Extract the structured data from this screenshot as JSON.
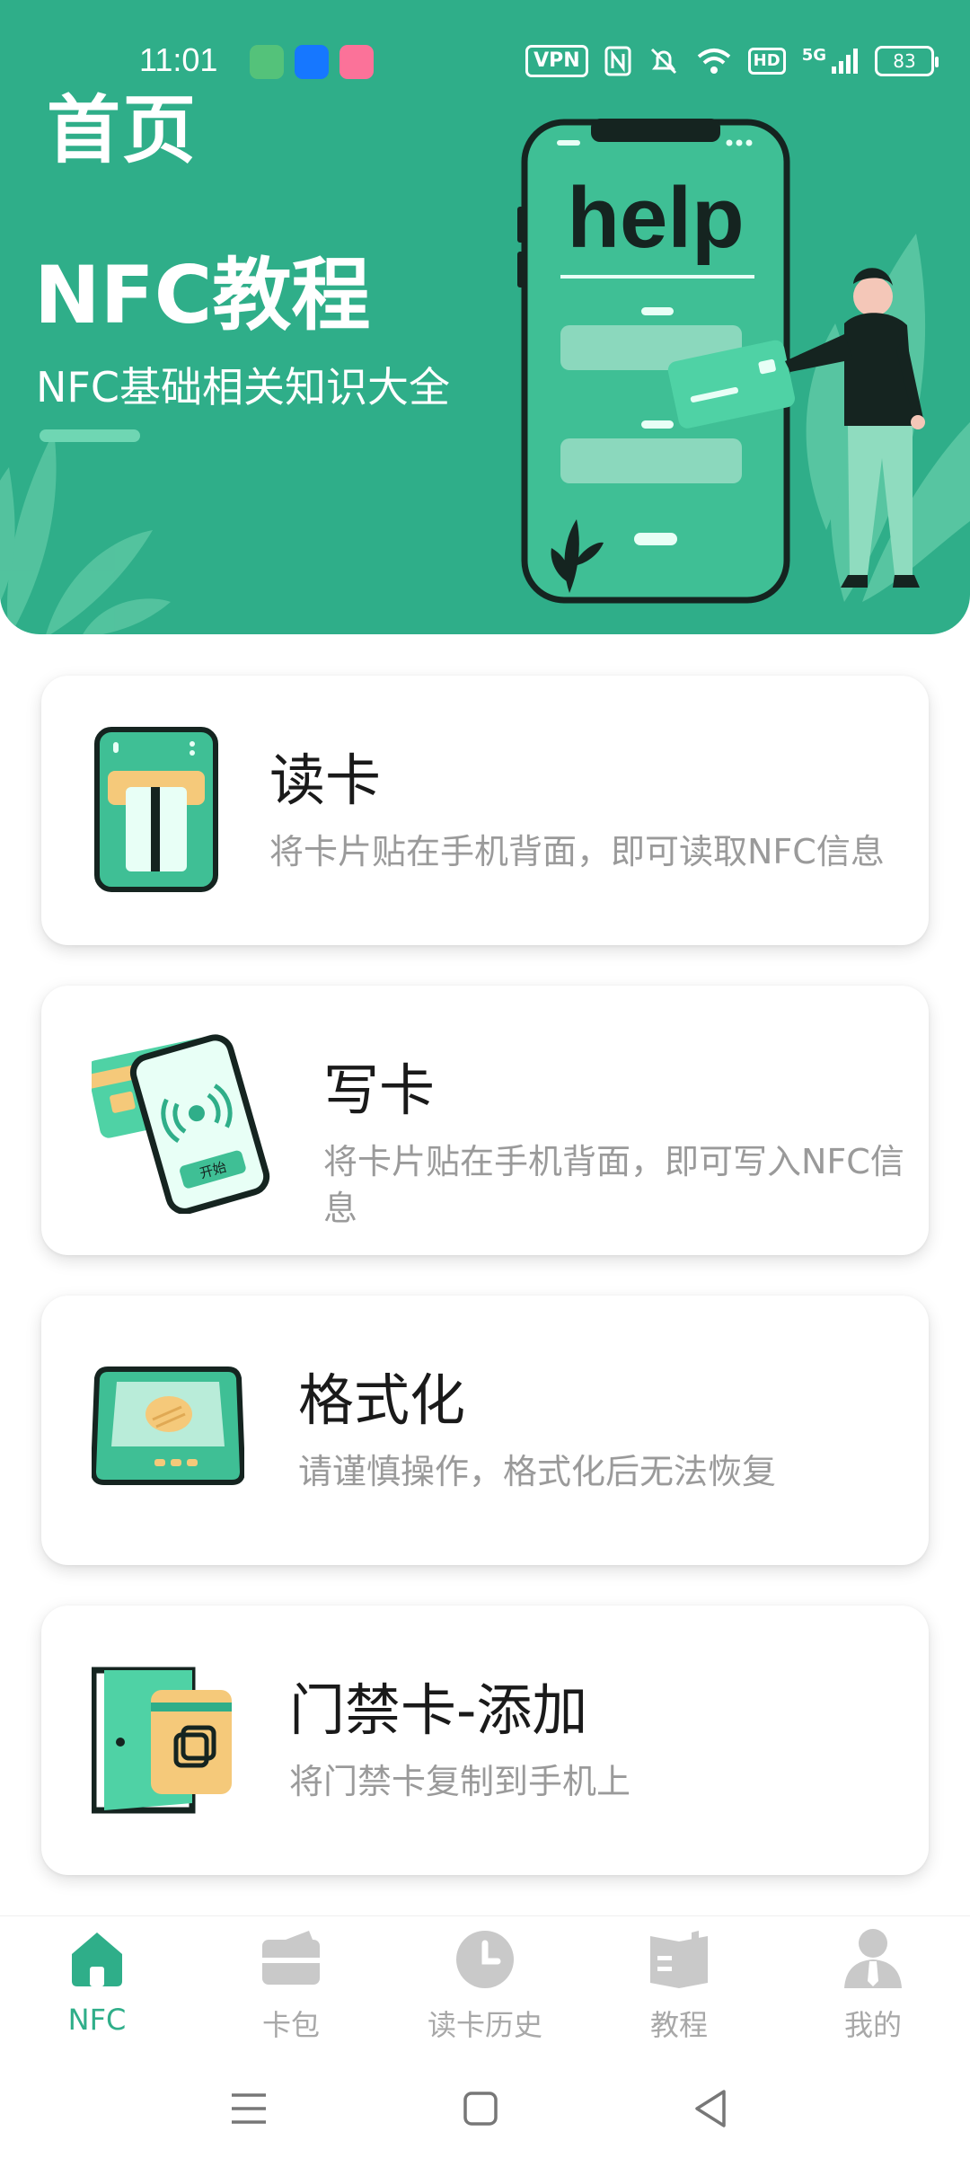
{
  "status_bar": {
    "time": "11:01",
    "vpn": "VPN",
    "hd": "HD",
    "network": "5G",
    "battery": "83",
    "icons": [
      "android-app-icon",
      "alipay-icon",
      "bilibili-icon",
      "nfc-icon",
      "mute-icon",
      "wifi-icon",
      "signal-icon"
    ]
  },
  "header": {
    "page_title": "首页",
    "hero_title": "NFC教程",
    "hero_subtitle": "NFC基础相关知识大全",
    "illustration_text": "help"
  },
  "cards": [
    {
      "title": "读卡",
      "description": "将卡片贴在手机背面，即可读取NFC信息",
      "icon": "read-card-icon"
    },
    {
      "title": "写卡",
      "description": "将卡片贴在手机背面，即可写入NFC信息",
      "icon": "write-card-icon",
      "icon_text": "开始"
    },
    {
      "title": "格式化",
      "description": "请谨慎操作，格式化后无法恢复",
      "icon": "format-icon"
    },
    {
      "title": "门禁卡-添加",
      "description": "将门禁卡复制到手机上",
      "icon": "access-card-icon"
    }
  ],
  "bottom_nav": [
    {
      "label": "NFC",
      "icon": "home-icon",
      "active": true
    },
    {
      "label": "卡包",
      "icon": "wallet-icon",
      "active": false
    },
    {
      "label": "读卡历史",
      "icon": "clock-icon",
      "active": false
    },
    {
      "label": "教程",
      "icon": "book-icon",
      "active": false
    },
    {
      "label": "我的",
      "icon": "user-icon",
      "active": false
    }
  ],
  "colors": {
    "primary": "#2fae89",
    "inactive": "#a8a8a8",
    "card_shadow": "#e0e0e0",
    "accent_yellow": "#f5c97a"
  }
}
